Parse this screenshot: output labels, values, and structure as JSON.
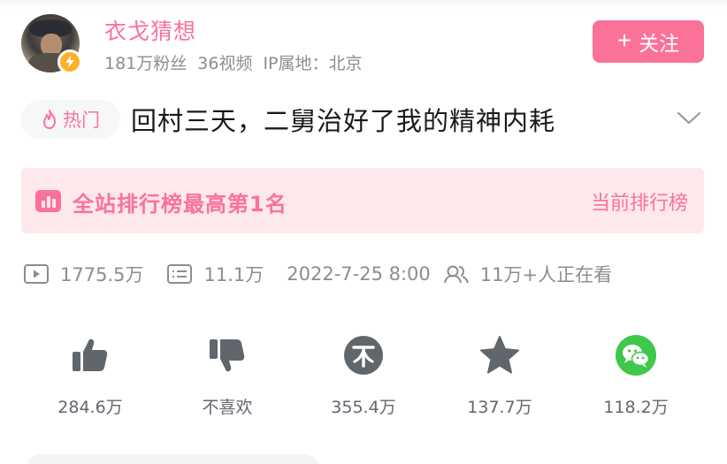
{
  "uploader": {
    "name": "衣戈猜想",
    "followers": "181万粉丝",
    "videos": "36视频",
    "ip": "IP属地：北京",
    "follow_label": "关注",
    "follow_plus": "+"
  },
  "video": {
    "hot_badge": "热门",
    "title": "回村三天，二舅治好了我的精神内耗"
  },
  "rank": {
    "text": "全站排行榜最高第1名",
    "link": "当前排行榜"
  },
  "meta": {
    "views": "1775.5万",
    "danmaku": "11.1万",
    "date": "2022-7-25 8:00",
    "watching": "11万+人正在看"
  },
  "actions": {
    "like": "284.6万",
    "dislike": "不喜欢",
    "coin": "355.4万",
    "favorite": "137.7万",
    "share": "118.2万"
  },
  "colors": {
    "accent": "#fb7299",
    "banner_bg": "#fde8ec",
    "verify": "#ffb027",
    "wechat": "#3fc84a",
    "icon_dark": "#61666d"
  },
  "icons": [
    "verified-bolt-icon",
    "flame-icon",
    "chevron-down-icon",
    "rank-bar-icon",
    "play-icon",
    "danmaku-icon",
    "watching-icon",
    "thumb-up-icon",
    "thumb-down-icon",
    "coin-icon",
    "star-icon",
    "wechat-icon"
  ]
}
